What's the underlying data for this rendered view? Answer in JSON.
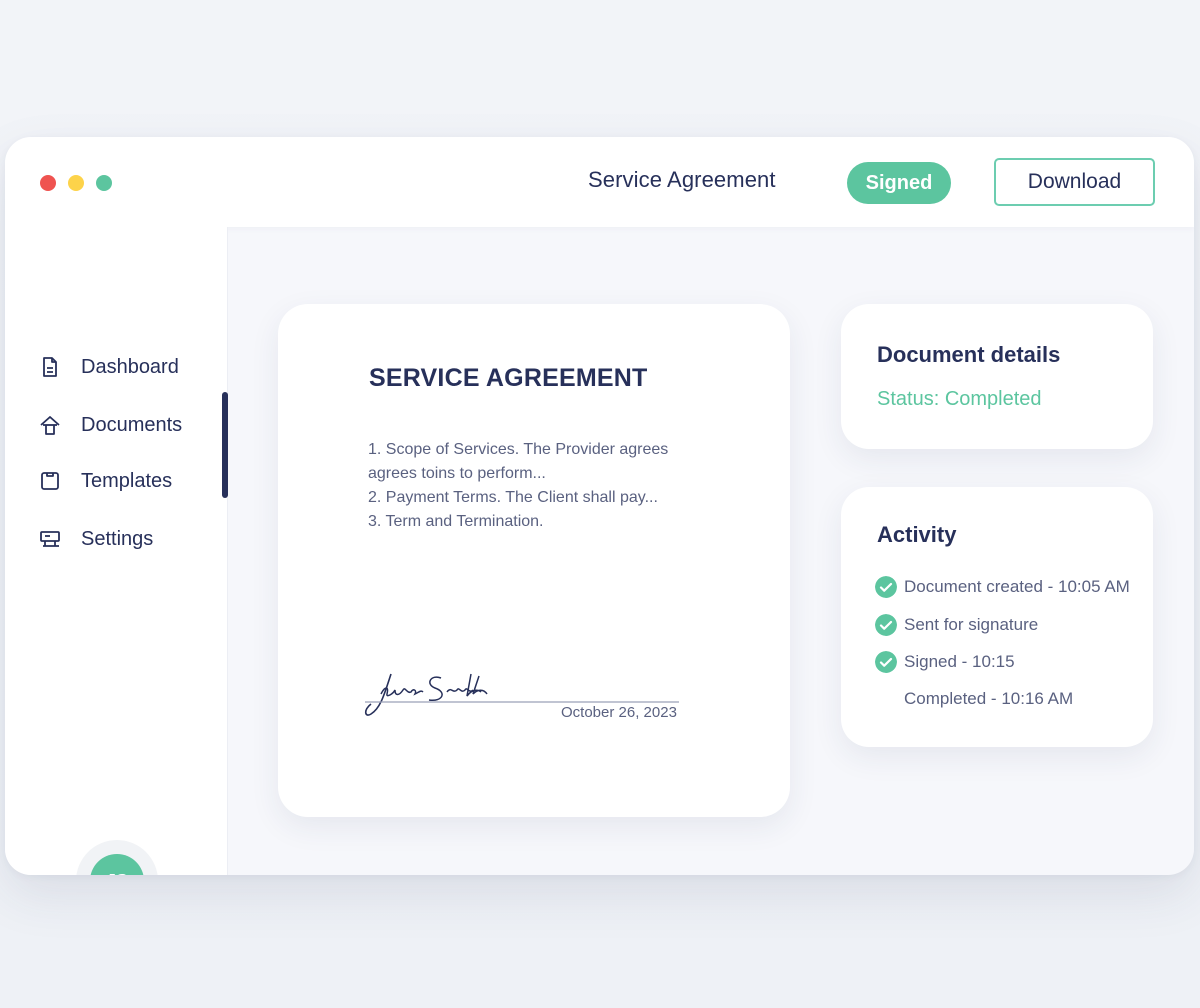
{
  "colors": {
    "accent_green": "#5cc59f",
    "dot_red": "#ef5350",
    "dot_yellow": "#fdd34a",
    "dot_green": "#5cc59f",
    "navy": "#27305a"
  },
  "window": {
    "title": "Service Agreement",
    "status_badge": "Signed",
    "download_label": "Download"
  },
  "sidebar": {
    "items": [
      {
        "label": "Dashboard",
        "icon": "document-icon"
      },
      {
        "label": "Documents",
        "icon": "home-icon"
      },
      {
        "label": "Templates",
        "icon": "template-icon"
      },
      {
        "label": "Settings",
        "icon": "settings-icon"
      }
    ],
    "active_item": "Documents",
    "avatar_initials": "JS"
  },
  "document": {
    "heading": "SERVICE AGREEMENT",
    "lines": [
      "1. Scope of Services. The Provider agrees",
      "agrees toins to perform...",
      "2. Payment Terms. The Client shall pay...",
      "3. Term and Termination."
    ],
    "signature_name": "Jane Smith",
    "signature_date": "October 26, 2023"
  },
  "details": {
    "title": "Document details",
    "status": "Status: Completed"
  },
  "activity": {
    "title": "Activity",
    "items": [
      {
        "text": "Document created - 10:05 AM",
        "checked": true
      },
      {
        "text": "Sent for signature",
        "checked": true
      },
      {
        "text": "Signed - 10:15",
        "checked": true
      },
      {
        "text": "Completed - 10:16 AM",
        "checked": false
      }
    ]
  }
}
